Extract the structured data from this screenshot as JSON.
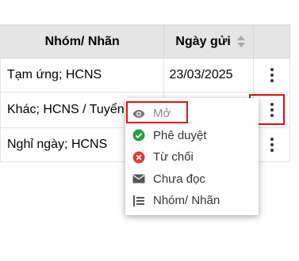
{
  "table": {
    "headers": {
      "group": "Nhóm/ Nhãn",
      "date": "Ngày gửi"
    },
    "rows": [
      {
        "group": "Tạm ứng; HCNS",
        "date": "23/03/2025"
      },
      {
        "group": "Khác; HCNS / Tuyển dụng",
        "date": ""
      },
      {
        "group": "Nghỉ ngày; HCNS",
        "date": ""
      }
    ]
  },
  "menu": {
    "items": [
      {
        "label": "Mở",
        "icon": "eye-icon",
        "disabled": true
      },
      {
        "label": "Phê duyệt",
        "icon": "check-circle-icon"
      },
      {
        "label": "Từ chối",
        "icon": "close-circle-icon"
      },
      {
        "label": "Chưa đọc",
        "icon": "envelope-icon"
      },
      {
        "label": "Nhóm/ Nhãn",
        "icon": "label-list-icon"
      }
    ]
  },
  "colors": {
    "header_bg": "#e5e5e5",
    "highlight": "#e01010",
    "approve": "#2e9e3e",
    "reject": "#e53935",
    "icon_gray": "#555555"
  }
}
